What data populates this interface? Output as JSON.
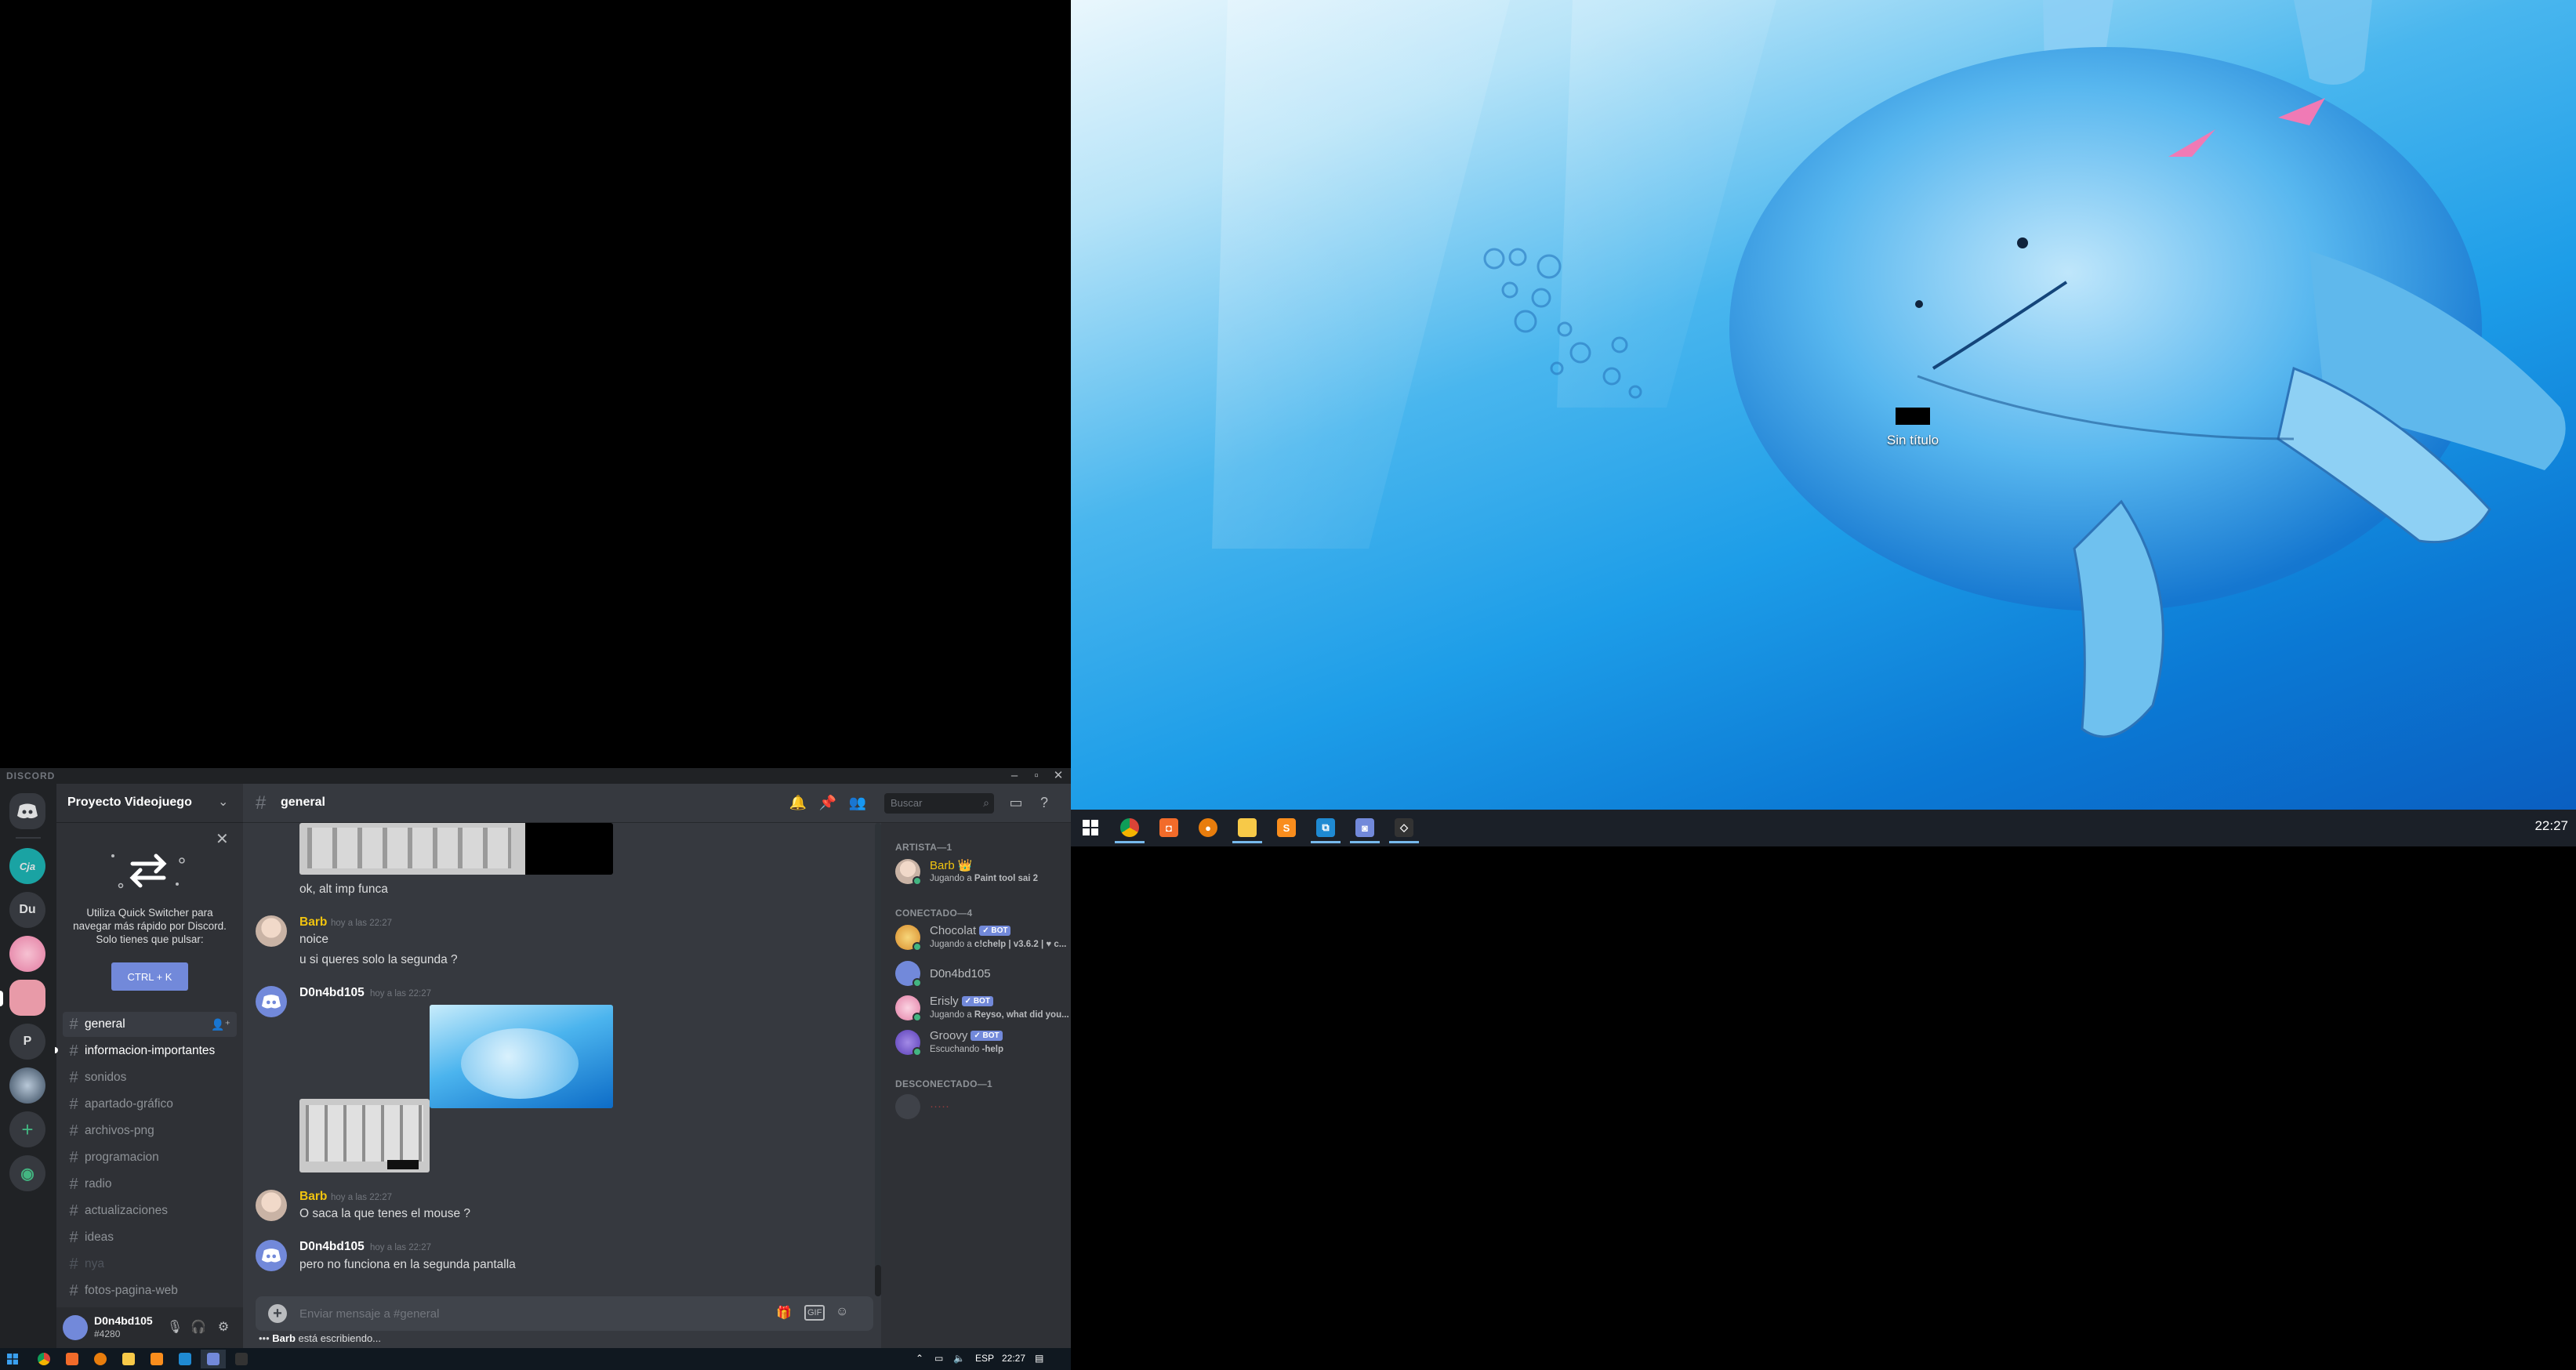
{
  "right_monitor": {
    "desktop_icon_label": "Sin título",
    "clock": "22:27",
    "taskbar_apps": [
      "windows-start",
      "chrome",
      "app-orange",
      "app-blender",
      "file-explorer",
      "sublime-text",
      "vscode",
      "discord",
      "unity"
    ]
  },
  "discord": {
    "window_title": "DISCORD",
    "server": {
      "name": "Proyecto Videojuego",
      "quick_switcher_text": "Utiliza Quick Switcher para navegar más rápido por Discord. Solo tienes que pulsar:",
      "quick_switcher_button": "CTRL + K"
    },
    "guilds": [
      "Du",
      "P"
    ],
    "channels": [
      {
        "name": "general",
        "state": "selected"
      },
      {
        "name": "informacion-importantes",
        "state": "unread"
      },
      {
        "name": "sonidos",
        "state": "normal"
      },
      {
        "name": "apartado-gráfico",
        "state": "normal"
      },
      {
        "name": "archivos-png",
        "state": "normal"
      },
      {
        "name": "programacion",
        "state": "normal"
      },
      {
        "name": "radio",
        "state": "normal"
      },
      {
        "name": "actualizaciones",
        "state": "normal"
      },
      {
        "name": "ideas",
        "state": "normal"
      },
      {
        "name": "nya",
        "state": "muted"
      },
      {
        "name": "fotos-pagina-web",
        "state": "normal"
      }
    ],
    "user": {
      "name": "D0n4bd105",
      "tag": "#4280"
    },
    "chat": {
      "channel": "general",
      "search_placeholder": "Buscar",
      "composer_placeholder": "Enviar mensaje a #general",
      "typing": {
        "user": "Barb",
        "text": "está escribiendo..."
      },
      "messages": [
        {
          "author": "",
          "timestamp": "",
          "lines": [
            "ok, alt imp funca"
          ]
        },
        {
          "author": "Barb",
          "timestamp": "hoy a las 22:27",
          "lines": [
            "noice",
            "u si queres solo la segunda ?"
          ]
        },
        {
          "author": "D0n4bd105",
          "timestamp": "hoy a las 22:27",
          "lines": []
        },
        {
          "author": "Barb",
          "timestamp": "hoy a las 22:27",
          "lines": [
            "O saca la que tenes el mouse ?"
          ]
        },
        {
          "author": "D0n4bd105",
          "timestamp": "hoy a las 22:27",
          "lines": [
            "pero no funciona en la segunda pantalla"
          ]
        }
      ]
    },
    "members": {
      "groups": [
        {
          "label": "ARTISTA—1",
          "members": [
            {
              "name": "Barb",
              "sub_prefix": "Jugando a ",
              "sub_bold": "Paint tool sai 2",
              "bot": false,
              "crown": "👑",
              "color": "#f1c40f"
            }
          ]
        },
        {
          "label": "CONECTADO—4",
          "members": [
            {
              "name": "Chocolat",
              "sub_prefix": "Jugando a ",
              "sub_bold": "c!chelp | v3.6.2 | ♥ c...",
              "bot": true,
              "color": "#b9bbbe"
            },
            {
              "name": "D0n4bd105",
              "sub_prefix": "",
              "sub_bold": "",
              "bot": false,
              "color": "#b9bbbe"
            },
            {
              "name": "Erisly",
              "sub_prefix": "Jugando a ",
              "sub_bold": "Reyso, what did you...",
              "bot": true,
              "color": "#b9bbbe"
            },
            {
              "name": "Groovy",
              "sub_prefix": "Escuchando ",
              "sub_bold": "-help",
              "bot": true,
              "color": "#b9bbbe"
            }
          ]
        },
        {
          "label": "DESCONECTADO—1",
          "members": [
            {
              "name": "·····",
              "sub_prefix": "",
              "sub_bold": "",
              "bot": false,
              "color": "#f04747"
            }
          ]
        }
      ],
      "bot_label": "✓ BOT"
    }
  },
  "left_taskbar": {
    "language": "ESP",
    "clock": "22:27"
  },
  "colors": {
    "discord_blurple": "#7289da",
    "barb_gold": "#f1c40f",
    "online_green": "#43b581"
  }
}
